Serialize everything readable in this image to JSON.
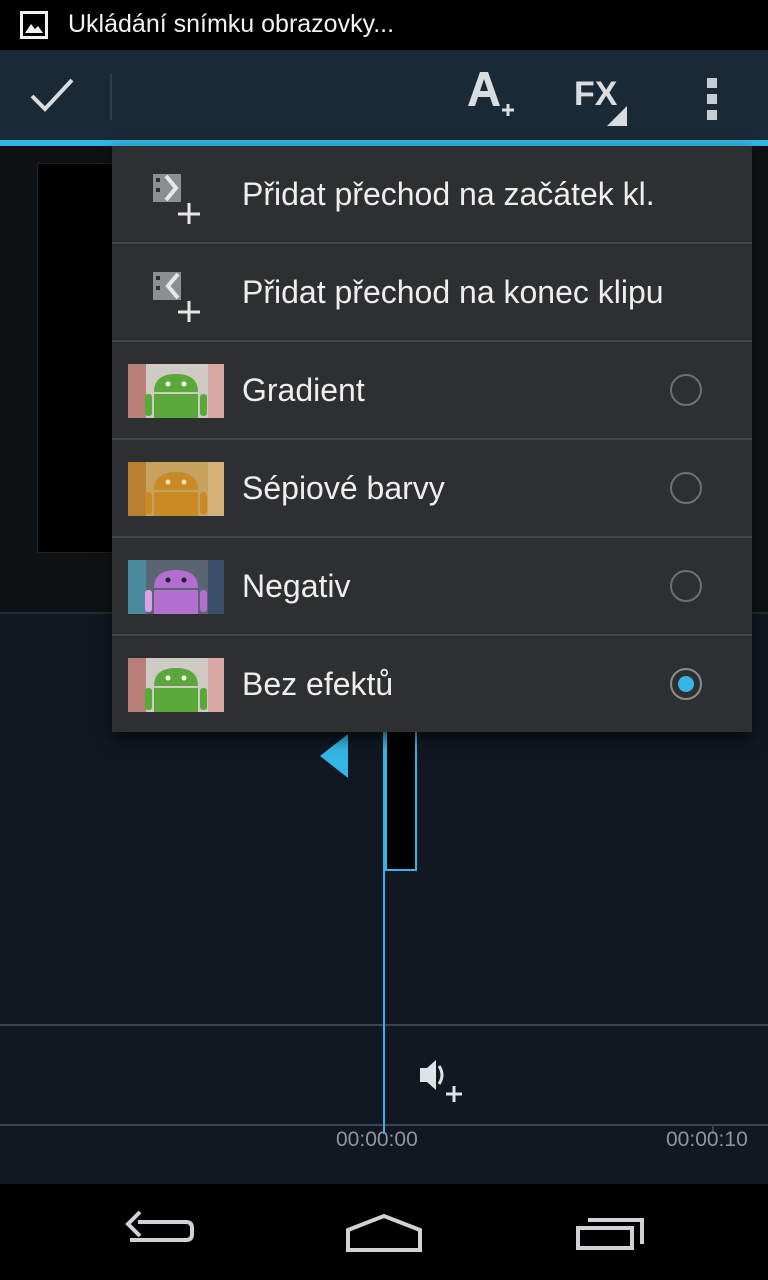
{
  "status_bar": {
    "icon": "picture-icon",
    "text": "Ukládání snímku obrazovky..."
  },
  "action_bar": {
    "done_icon": "checkmark-icon",
    "add_title_icon": "add-title-icon",
    "effects_label": "FX",
    "overflow_icon": "overflow-menu-icon",
    "accent_color": "#33b5e5",
    "bar_color": "#1a2936"
  },
  "menu": {
    "items": [
      {
        "label": "Přidat přechod na začátek kl.",
        "icon": "add-transition-start-icon"
      },
      {
        "label": "Přidat přechod na konec klipu",
        "icon": "add-transition-end-icon"
      },
      {
        "label": "Gradient",
        "thumbnail": "android-green-thumbnail",
        "checked": false
      },
      {
        "label": "Sépiové barvy",
        "thumbnail": "android-sepia-thumbnail",
        "checked": false
      },
      {
        "label": "Negativ",
        "thumbnail": "android-negative-thumbnail",
        "checked": false
      },
      {
        "label": "Bez efektů",
        "thumbnail": "android-green-thumbnail",
        "checked": true
      }
    ]
  },
  "timeline": {
    "timecode_start": "00:00:00",
    "timecode_end": "00:00:10",
    "add_audio_icon": "add-audio-icon"
  },
  "nav_bar": {
    "back_icon": "back-icon",
    "home_icon": "home-icon",
    "recents_icon": "recents-icon"
  }
}
